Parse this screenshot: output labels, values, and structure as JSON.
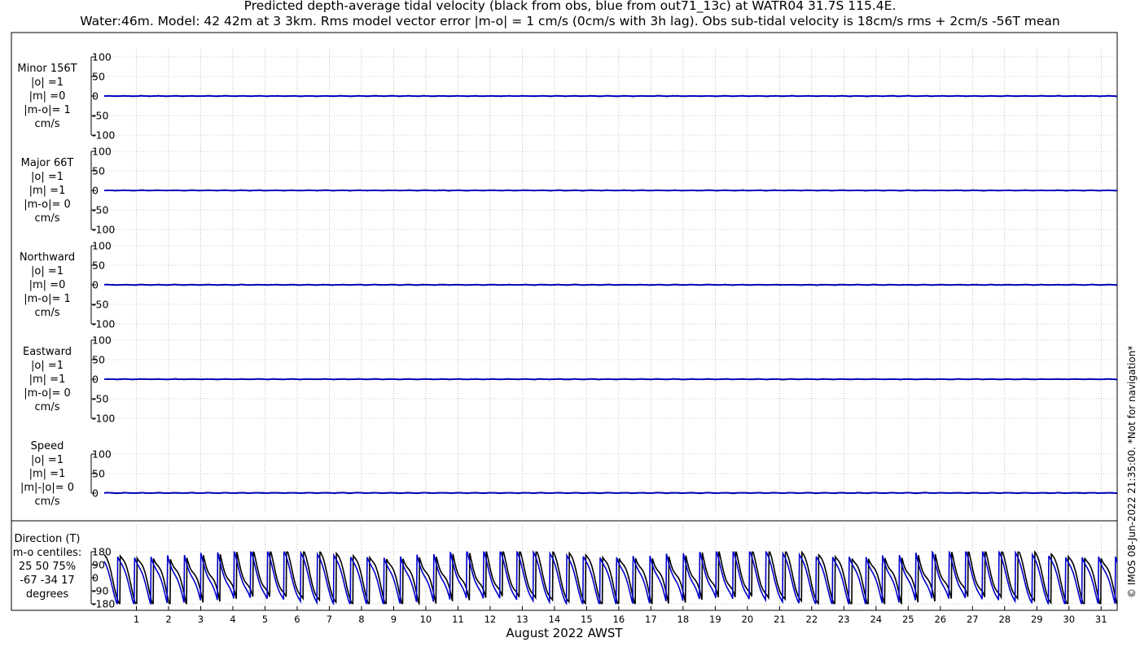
{
  "header": {
    "title_line1": "Predicted depth-average tidal velocity (black from obs, blue from out71_13c) at WATR04 31.7S 115.4E.",
    "title_line2": "Water:46m. Model: 42 42m at 3 3km. Rms model vector error |m-o| = 1 cm/s (0cm/s with 3h lag). Obs sub-tidal velocity is 18cm/s rms + 2cm/s -56T mean"
  },
  "watermark": "© IMOS 08-Jun-2022 21:35:00. *Not for navigation*",
  "colors": {
    "obs": "#000000",
    "model": "#0000cc",
    "grid": "#999999",
    "axis": "#000000"
  },
  "chart_data": [
    {
      "type": "line",
      "panel": "Minor 156T",
      "labels": [
        "Minor 156T",
        "|o| =1",
        "|m| =0",
        "|m-o|= 1",
        "cm/s"
      ],
      "ylim": [
        -100,
        100
      ],
      "yticks": [
        "100",
        "50",
        "0",
        "-50",
        "-100"
      ],
      "series": [
        {
          "name": "obs",
          "color": "#000000",
          "values_summary": "near 0 throughout, amplitude ~1 cm/s"
        },
        {
          "name": "model",
          "color": "#0000cc",
          "values_summary": "0 throughout"
        }
      ]
    },
    {
      "type": "line",
      "panel": "Major 66T",
      "labels": [
        "Major 66T",
        "|o| =1",
        "|m| =1",
        "|m-o|= 0",
        "cm/s"
      ],
      "ylim": [
        -100,
        100
      ],
      "yticks": [
        "100",
        "50",
        "0",
        "-50",
        "-100"
      ],
      "series": [
        {
          "name": "obs",
          "color": "#000000",
          "values_summary": "near 0 throughout, amplitude ~1 cm/s"
        },
        {
          "name": "model",
          "color": "#0000cc",
          "values_summary": "near 0 throughout, amplitude ~1 cm/s"
        }
      ]
    },
    {
      "type": "line",
      "panel": "Northward",
      "labels": [
        "Northward",
        "|o| =1",
        "|m| =0",
        "|m-o|= 1",
        "cm/s"
      ],
      "ylim": [
        -100,
        100
      ],
      "yticks": [
        "100",
        "50",
        "0",
        "-50",
        "-100"
      ],
      "series": [
        {
          "name": "obs",
          "color": "#000000",
          "values_summary": "near 0 throughout"
        },
        {
          "name": "model",
          "color": "#0000cc",
          "values_summary": "0 throughout"
        }
      ]
    },
    {
      "type": "line",
      "panel": "Eastward",
      "labels": [
        "Eastward",
        "|o| =1",
        "|m| =1",
        "|m-o|= 0",
        "cm/s"
      ],
      "ylim": [
        -100,
        100
      ],
      "yticks": [
        "100",
        "50",
        "0",
        "-50",
        "-100"
      ],
      "series": [
        {
          "name": "obs",
          "color": "#000000",
          "values_summary": "near 0 throughout"
        },
        {
          "name": "model",
          "color": "#0000cc",
          "values_summary": "near 0 throughout"
        }
      ]
    },
    {
      "type": "line",
      "panel": "Speed",
      "labels": [
        "Speed",
        "|o| =1",
        "|m| =1",
        "|m|-|o|= 0",
        "cm/s"
      ],
      "ylim": [
        0,
        100
      ],
      "yticks": [
        "100",
        "50",
        "0"
      ],
      "series": [
        {
          "name": "obs",
          "color": "#000000",
          "values_summary": "~0-1 cm/s throughout"
        },
        {
          "name": "model",
          "color": "#0000cc",
          "values_summary": "~0-1 cm/s throughout"
        }
      ]
    },
    {
      "type": "line",
      "panel": "Direction (T)",
      "labels": [
        "Direction (T)",
        "m-o centiles:",
        "25  50  75%",
        "-67 -34  17",
        "degrees"
      ],
      "ylim": [
        -180,
        180
      ],
      "yticks": [
        "180",
        "90",
        "0",
        "-90",
        "-180"
      ],
      "series": [
        {
          "name": "obs",
          "color": "#000000",
          "values_summary": "semi-diurnal sawtooth between ~-170 and ~170 degrees"
        },
        {
          "name": "model",
          "color": "#0000cc",
          "values_summary": "semi-diurnal sawtooth between ~-170 and ~170 degrees, offset from obs"
        }
      ]
    }
  ],
  "xaxis": {
    "label": "August 2022 AWST",
    "range_days": [
      0,
      31.5
    ],
    "ticks": [
      "1",
      "2",
      "3",
      "4",
      "5",
      "6",
      "7",
      "8",
      "9",
      "10",
      "11",
      "12",
      "13",
      "14",
      "15",
      "16",
      "17",
      "18",
      "19",
      "20",
      "21",
      "22",
      "23",
      "24",
      "25",
      "26",
      "27",
      "28",
      "29",
      "30",
      "31"
    ],
    "grid": true
  }
}
